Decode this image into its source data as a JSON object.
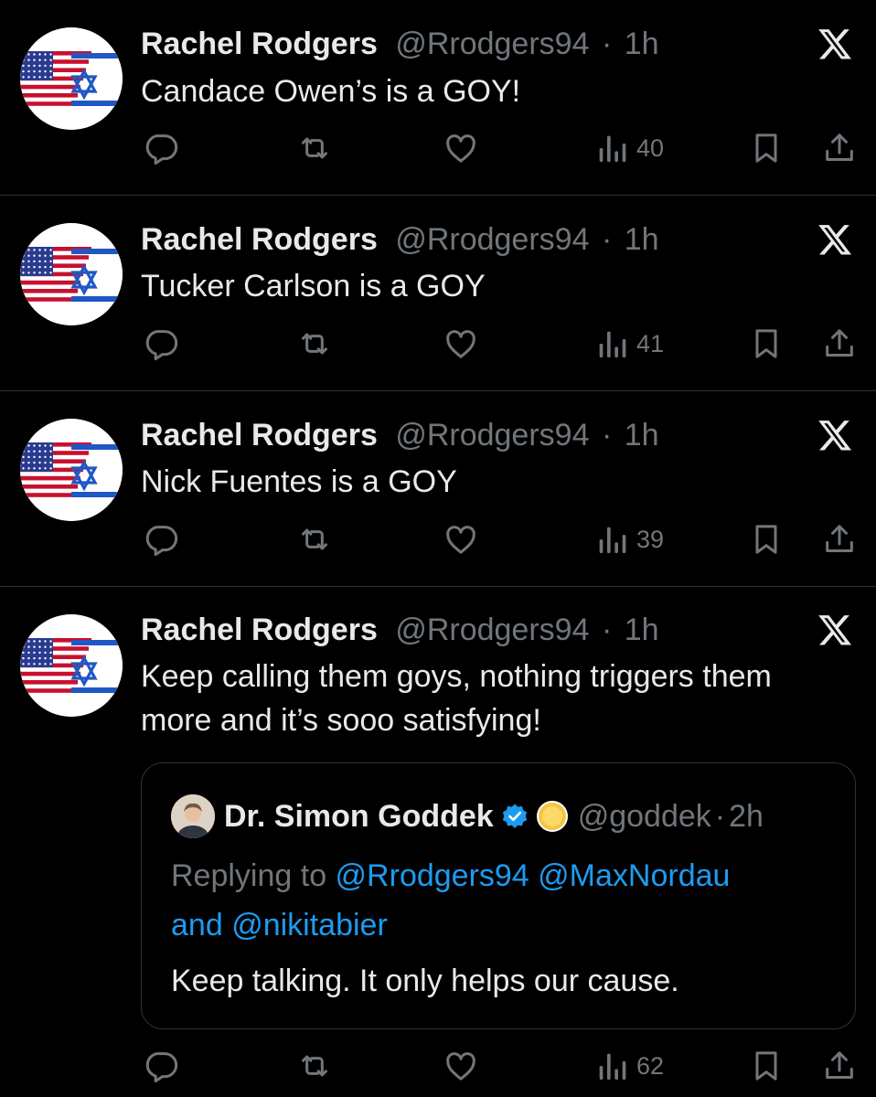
{
  "tweets": [
    {
      "name": "Rachel Rodgers",
      "handle": "@Rrodgers94",
      "sep": "·",
      "time": "1h",
      "text": "Candace Owen’s is a GOY!",
      "views": "40"
    },
    {
      "name": "Rachel Rodgers",
      "handle": "@Rrodgers94",
      "sep": "·",
      "time": "1h",
      "text": "Tucker Carlson is a GOY",
      "views": "41"
    },
    {
      "name": "Rachel Rodgers",
      "handle": "@Rrodgers94",
      "sep": "·",
      "time": "1h",
      "text": "Nick Fuentes is a GOY",
      "views": "39"
    },
    {
      "name": "Rachel Rodgers",
      "handle": "@Rrodgers94",
      "sep": "·",
      "time": "1h",
      "text_line1": "Keep calling them goys, nothing triggers them",
      "text_line2": "more and it’s sooo satisfying!",
      "views": "62",
      "quote": {
        "name": "Dr. Simon Goddek",
        "handle": "@goddek",
        "sep": "·",
        "time": "2h",
        "replying_prefix": "Replying to ",
        "mention1": "@Rrodgers94",
        "mention2": "@MaxNordau",
        "and_word": "and ",
        "mention3": "@nikitabier",
        "text": "Keep talking. It only helps our cause."
      }
    }
  ],
  "icons": {
    "reply": "reply-icon",
    "repost": "repost-icon",
    "like": "like-icon",
    "views": "views-icon",
    "bookmark": "bookmark-icon",
    "share": "share-icon",
    "platform": "x-logo-icon",
    "verified": "verified-badge-icon"
  },
  "colors": {
    "background": "#000000",
    "text": "#e7e9ea",
    "muted": "#71767b",
    "link": "#1d9bf0",
    "divider": "#2f3336"
  }
}
